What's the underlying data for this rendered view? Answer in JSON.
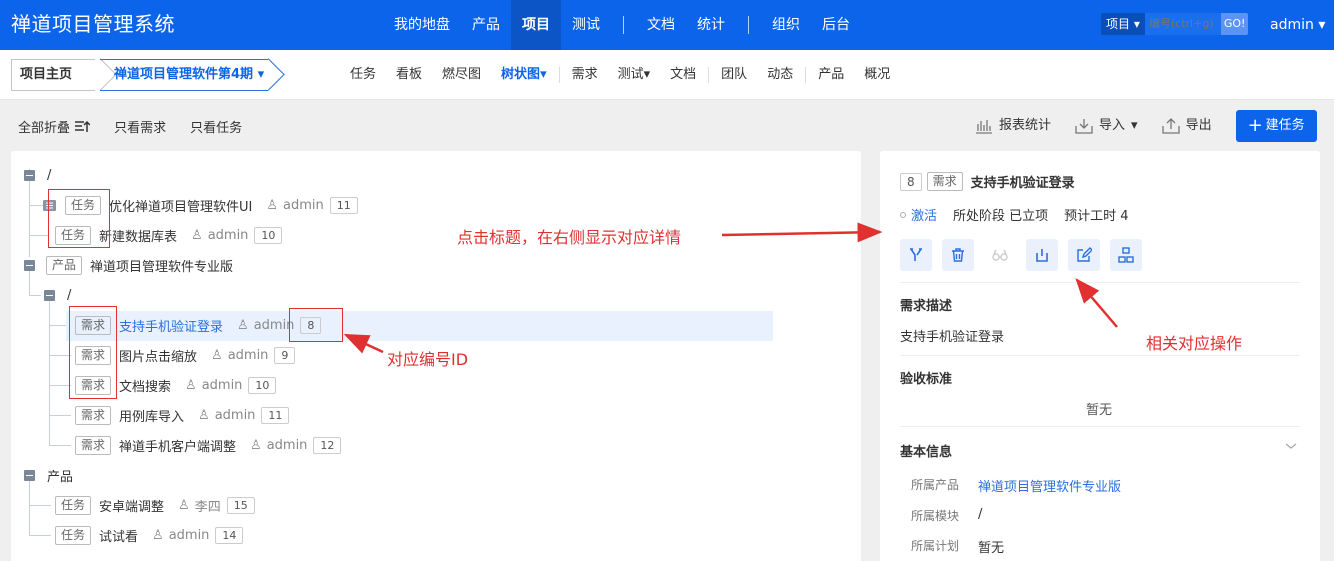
{
  "header": {
    "app_title": "禅道项目管理系统",
    "nav": [
      "我的地盘",
      "产品",
      "项目",
      "测试",
      "文档",
      "统计",
      "组织",
      "后台"
    ],
    "search_type": "项目",
    "search_placeholder": "编号(ctrl+g)",
    "search_go": "GO!",
    "user": "admin"
  },
  "subheader": {
    "crumb_home": "项目主页",
    "crumb_project": "禅道项目管理软件第4期",
    "tabs": [
      "任务",
      "看板",
      "燃尽图",
      "树状图",
      "需求",
      "测试",
      "文档",
      "团队",
      "动态",
      "产品",
      "概况"
    ],
    "active_tab": "树状图"
  },
  "toolbar": {
    "collapse_all": "全部折叠",
    "only_story": "只看需求",
    "only_task": "只看任务",
    "report": "报表统计",
    "import": "导入",
    "export": "导出",
    "create_task": "建任务"
  },
  "tree": {
    "root1": "/",
    "task1": {
      "tag": "任务",
      "title": "优化禅道项目管理软件UI",
      "user": "admin",
      "id": "11"
    },
    "task2": {
      "tag": "任务",
      "title": "新建数据库表",
      "user": "admin",
      "id": "10"
    },
    "product": {
      "tag": "产品",
      "title": "禅道项目管理软件专业版"
    },
    "module": "/",
    "stories": [
      {
        "tag": "需求",
        "title": "支持手机验证登录",
        "user": "admin",
        "id": "8"
      },
      {
        "tag": "需求",
        "title": "图片点击缩放",
        "user": "admin",
        "id": "9"
      },
      {
        "tag": "需求",
        "title": "文档搜索",
        "user": "admin",
        "id": "10"
      },
      {
        "tag": "需求",
        "title": "用例库导入",
        "user": "admin",
        "id": "11"
      },
      {
        "tag": "需求",
        "title": "禅道手机客户端调整",
        "user": "admin",
        "id": "12"
      }
    ],
    "group2": "产品",
    "tasks2": [
      {
        "tag": "任务",
        "title": "安卓端调整",
        "user": "李四",
        "id": "15"
      },
      {
        "tag": "任务",
        "title": "试试看",
        "user": "admin",
        "id": "14"
      }
    ]
  },
  "detail": {
    "id": "8",
    "tag": "需求",
    "title": "支持手机验证登录",
    "status": "激活",
    "stage": "所处阶段 已立项",
    "estimate": "预计工时 4",
    "desc_title": "需求描述",
    "desc": "支持手机验证登录",
    "verify_title": "验收标准",
    "verify": "暂无",
    "basic_title": "基本信息",
    "product_label": "所属产品",
    "product_value": "禅道项目管理软件专业版",
    "module_label": "所属模块",
    "module_value": "/",
    "plan_label": "所属计划",
    "plan_value": "暂无"
  },
  "annotations": {
    "click_title": "点击标题，在右侧显示对应详情",
    "id_note": "对应编号ID",
    "ops_note": "相关对应操作"
  },
  "colors": {
    "brand": "#0c64eb",
    "annotation": "#e03030"
  }
}
